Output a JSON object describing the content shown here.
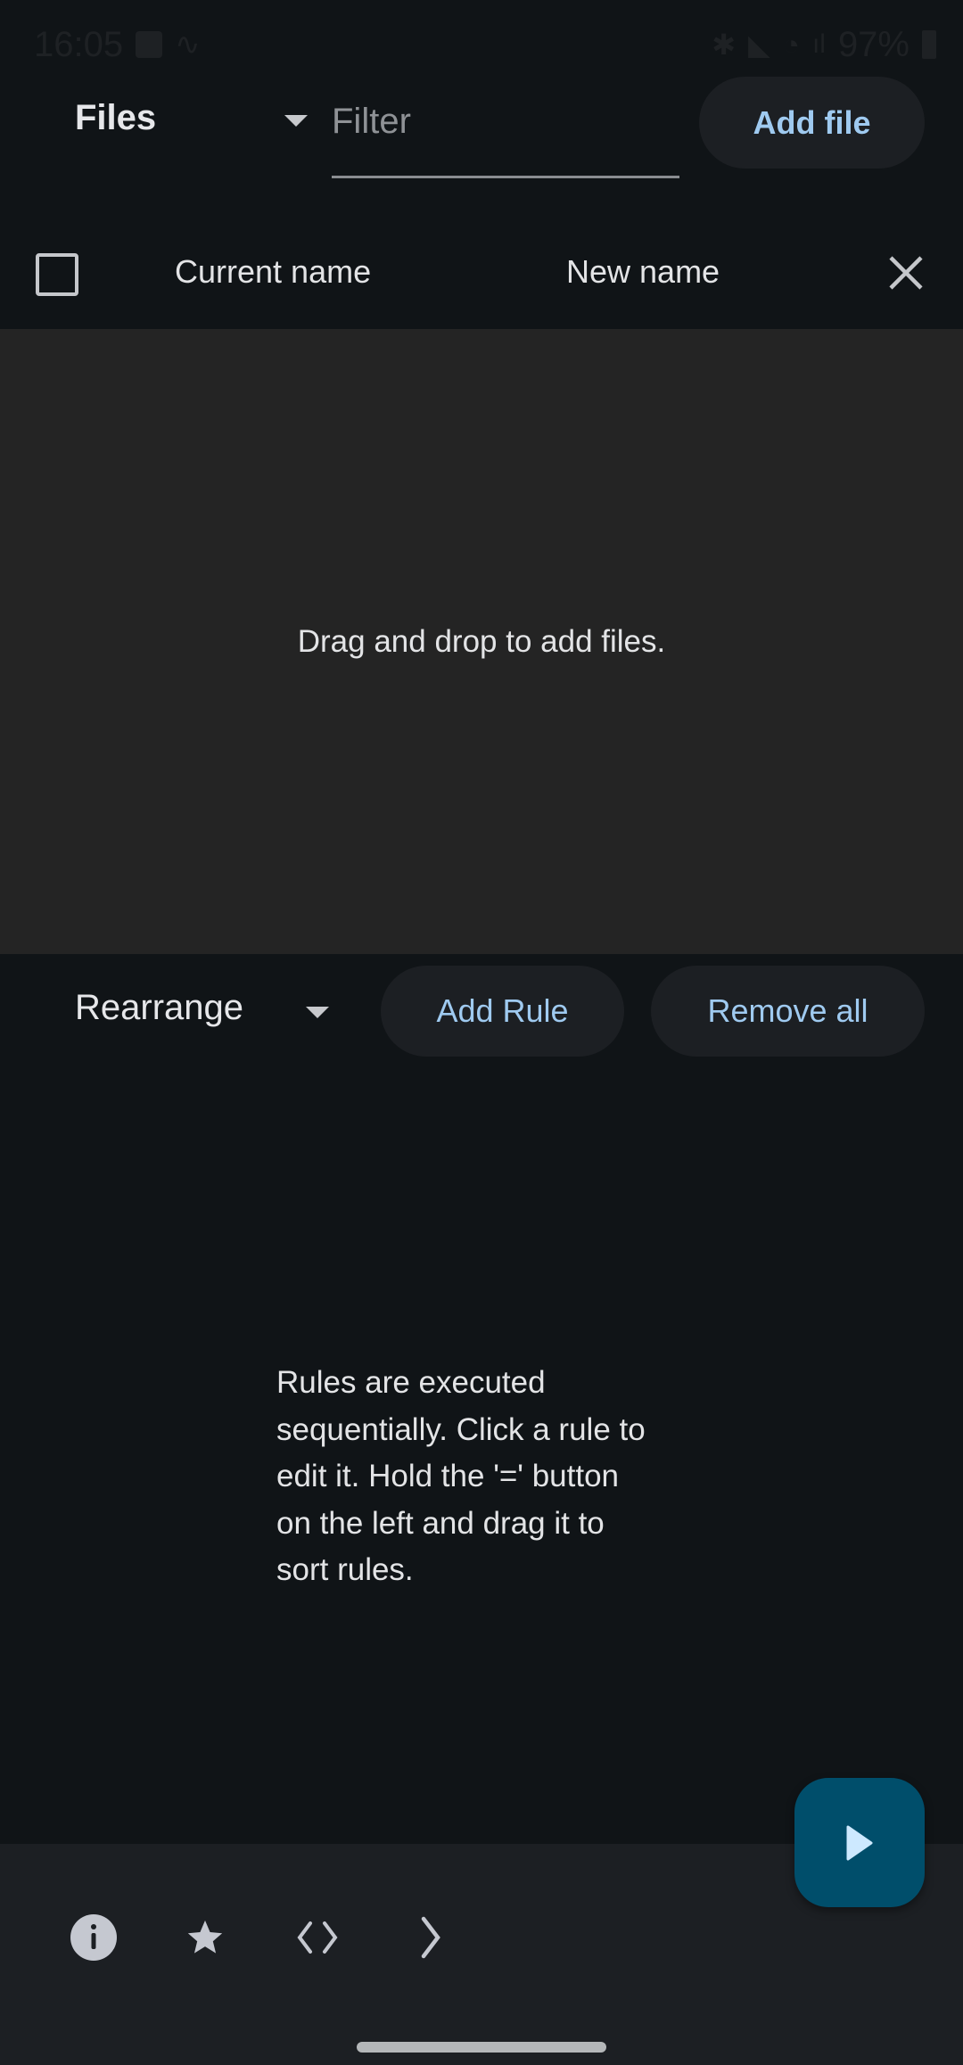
{
  "status_bar": {
    "time": "16:05",
    "battery": "97%"
  },
  "files": {
    "title": "Files",
    "filter_placeholder": "Filter",
    "add_file_label": "Add file",
    "columns": {
      "current": "Current name",
      "new": "New name"
    },
    "empty_message": "Drag and drop to add files."
  },
  "rules": {
    "selected_mode": "Rearrange",
    "add_rule_label": "Add Rule",
    "remove_all_label": "Remove all",
    "help_lines": [
      "Rules are executed",
      "sequentially. Click a rule to",
      "edit it. Hold the '=' button",
      "on the left and drag it to",
      "sort rules."
    ]
  },
  "bottom_bar": {
    "icons": [
      "info-icon",
      "star-icon",
      "code-icon",
      "chevron-right-icon"
    ]
  },
  "fab": {
    "icon": "play-icon"
  },
  "colors": {
    "accent": "#9fcaf0",
    "fab": "#004e6b",
    "background": "#101417",
    "drop_area": "#242424"
  }
}
